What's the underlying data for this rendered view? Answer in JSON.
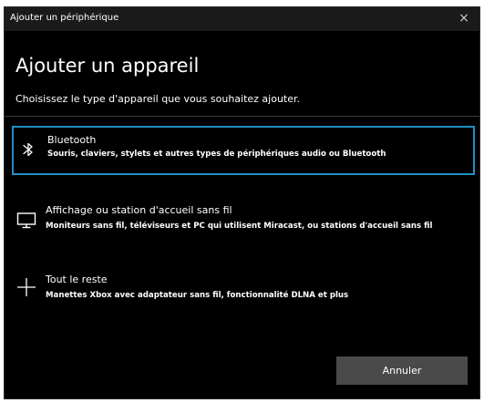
{
  "window": {
    "title": "Ajouter un périphérique",
    "close_glyph": "×"
  },
  "heading": "Ajouter un appareil",
  "subheading": "Choisissez le type d'appareil que vous souhaitez ajouter.",
  "options": [
    {
      "label": "Bluetooth",
      "description": "Souris, claviers, stylets et autres types de périphériques audio ou Bluetooth",
      "icon": "bluetooth-icon",
      "selected": true
    },
    {
      "label": "Affichage ou station d'accueil sans fil",
      "description": "Moniteurs sans fil, téléviseurs et PC qui utilisent Miracast, ou stations d'accueil sans fil",
      "icon": "monitor-icon",
      "selected": false
    },
    {
      "label": "Tout le reste",
      "description": "Manettes Xbox avec adaptateur sans fil, fonctionnalité DLNA et plus",
      "icon": "plus-icon",
      "selected": false
    }
  ],
  "buttons": {
    "cancel_label": "Annuler"
  },
  "colors": {
    "background": "#000000",
    "selection_border": "#1f8fc6",
    "button_background": "#4a4a4a"
  }
}
